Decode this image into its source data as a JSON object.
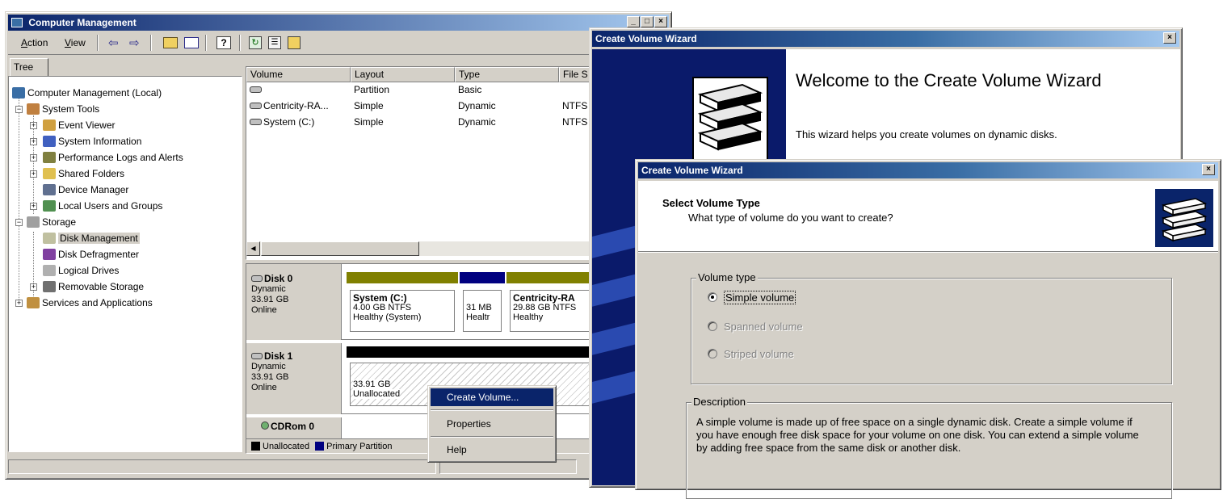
{
  "cm": {
    "title": "Computer Management",
    "menu": {
      "action": "Action",
      "view": "View"
    },
    "tree_tab": "Tree",
    "tree": [
      {
        "label": "Computer Management (Local)"
      },
      {
        "label": "System Tools"
      },
      {
        "label": "Event Viewer"
      },
      {
        "label": "System Information"
      },
      {
        "label": "Performance Logs and Alerts"
      },
      {
        "label": "Shared Folders"
      },
      {
        "label": "Device Manager"
      },
      {
        "label": "Local Users and Groups"
      },
      {
        "label": "Storage"
      },
      {
        "label": "Disk Management"
      },
      {
        "label": "Disk Defragmenter"
      },
      {
        "label": "Logical Drives"
      },
      {
        "label": "Removable Storage"
      },
      {
        "label": "Services and Applications"
      }
    ],
    "columns": [
      "Volume",
      "Layout",
      "Type",
      "File S"
    ],
    "rows": [
      {
        "volume": "",
        "layout": "Partition",
        "type": "Basic",
        "fs": ""
      },
      {
        "volume": "Centricity-RA...",
        "layout": "Simple",
        "type": "Dynamic",
        "fs": "NTFS"
      },
      {
        "volume": "System (C:)",
        "layout": "Simple",
        "type": "Dynamic",
        "fs": "NTFS"
      }
    ],
    "disks": [
      {
        "name": "Disk 0",
        "kind": "Dynamic",
        "size": "33.91 GB",
        "status": "Online",
        "parts": [
          {
            "name": "System (C:)",
            "size": "4.00 GB NTFS",
            "health": "Healthy (System)"
          },
          {
            "name": "",
            "size": "31 MB",
            "health": "Healtr"
          },
          {
            "name": "Centricity-RA",
            "size": "29.88 GB NTFS",
            "health": "Healthy"
          }
        ]
      },
      {
        "name": "Disk 1",
        "kind": "Dynamic",
        "size": "33.91 GB",
        "status": "Online",
        "parts": [
          {
            "name": "",
            "size": "33.91 GB",
            "health": "Unallocated"
          }
        ]
      }
    ],
    "cdrom_partial": "CDRom 0",
    "legend": {
      "unallocated": "Unallocated",
      "primary": "Primary Partition"
    },
    "context_menu": [
      "Create Volume...",
      "Properties",
      "Help"
    ],
    "colors": {
      "olive": "#808000",
      "navy": "#000080",
      "black": "#000000",
      "highlight": "#0a246a"
    }
  },
  "wizard1": {
    "title": "Create Volume Wizard",
    "heading": "Welcome to the Create Volume Wizard",
    "text": "This wizard helps you create volumes on dynamic disks."
  },
  "wizard2": {
    "title": "Create Volume Wizard",
    "header_title": "Select Volume Type",
    "header_sub": "What type of volume do you want to create?",
    "group_volume_type": "Volume type",
    "options": [
      {
        "label": "Simple volume",
        "selected": true,
        "enabled": true
      },
      {
        "label": "Spanned volume",
        "selected": false,
        "enabled": false
      },
      {
        "label": "Striped volume",
        "selected": false,
        "enabled": false
      }
    ],
    "group_description": "Description",
    "description": "A simple volume is made up of free space on a single dynamic disk. Create a simple volume if you have enough free disk space for your volume on one disk. You can extend a simple volume by adding free space from the same disk or another disk."
  }
}
